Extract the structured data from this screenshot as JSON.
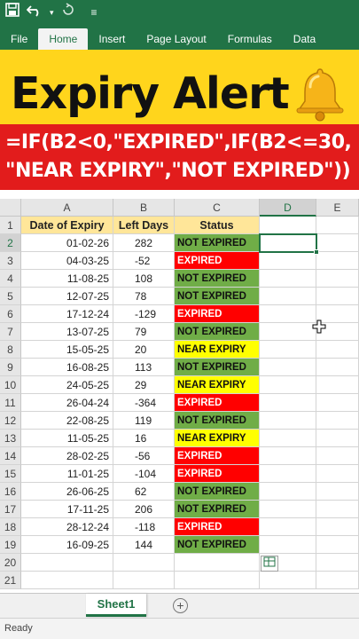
{
  "titlebar": {
    "save_icon": "save-icon",
    "undo_icon": "undo-icon",
    "redo_icon": "redo-icon"
  },
  "ribbon": {
    "tabs": [
      {
        "label": "File",
        "active": false
      },
      {
        "label": "Home",
        "active": true
      },
      {
        "label": "Insert",
        "active": false
      },
      {
        "label": "Page Layout",
        "active": false
      },
      {
        "label": "Formulas",
        "active": false
      },
      {
        "label": "Data",
        "active": false
      }
    ]
  },
  "banner": {
    "title": "Expiry Alert",
    "bg_color": "#ffd51c"
  },
  "formula": {
    "line1": "=IF(B2<0,\"EXPIRED\",IF(B2<=30,",
    "line2": "\"NEAR EXPIRY\",\"NOT EXPIRED\"))",
    "bg_color": "#e21c1c"
  },
  "sheet": {
    "columns": [
      "A",
      "B",
      "C",
      "D",
      "E"
    ],
    "headers": {
      "a": "Date of Expiry",
      "b": "Left Days",
      "c": "Status"
    },
    "rows": [
      {
        "n": "2",
        "date": "01-02-26",
        "days": "282",
        "status": "NOT EXPIRED"
      },
      {
        "n": "3",
        "date": "04-03-25",
        "days": "-52",
        "status": "EXPIRED"
      },
      {
        "n": "4",
        "date": "11-08-25",
        "days": "108",
        "status": "NOT EXPIRED"
      },
      {
        "n": "5",
        "date": "12-07-25",
        "days": "78",
        "status": "NOT EXPIRED"
      },
      {
        "n": "6",
        "date": "17-12-24",
        "days": "-129",
        "status": "EXPIRED"
      },
      {
        "n": "7",
        "date": "13-07-25",
        "days": "79",
        "status": "NOT EXPIRED"
      },
      {
        "n": "8",
        "date": "15-05-25",
        "days": "20",
        "status": "NEAR EXPIRY"
      },
      {
        "n": "9",
        "date": "16-08-25",
        "days": "113",
        "status": "NOT EXPIRED"
      },
      {
        "n": "10",
        "date": "24-05-25",
        "days": "29",
        "status": "NEAR EXPIRY"
      },
      {
        "n": "11",
        "date": "26-04-24",
        "days": "-364",
        "status": "EXPIRED"
      },
      {
        "n": "12",
        "date": "22-08-25",
        "days": "119",
        "status": "NOT EXPIRED"
      },
      {
        "n": "13",
        "date": "11-05-25",
        "days": "16",
        "status": "NEAR EXPIRY"
      },
      {
        "n": "14",
        "date": "28-02-25",
        "days": "-56",
        "status": "EXPIRED"
      },
      {
        "n": "15",
        "date": "11-01-25",
        "days": "-104",
        "status": "EXPIRED"
      },
      {
        "n": "16",
        "date": "26-06-25",
        "days": "62",
        "status": "NOT EXPIRED"
      },
      {
        "n": "17",
        "date": "17-11-25",
        "days": "206",
        "status": "NOT EXPIRED"
      },
      {
        "n": "18",
        "date": "28-12-24",
        "days": "-118",
        "status": "EXPIRED"
      },
      {
        "n": "19",
        "date": "16-09-25",
        "days": "144",
        "status": "NOT EXPIRED"
      }
    ],
    "empty_rows": [
      "20",
      "21"
    ],
    "header_row": "1",
    "status_colors": {
      "NOT EXPIRED": "#70ad47",
      "EXPIRED": "#ff0000",
      "NEAR EXPIRY": "#ffff00"
    },
    "active_cell": "D2"
  },
  "tabs": {
    "sheet_name": "Sheet1",
    "add_icon": "plus-circle-icon"
  },
  "statusbar": {
    "text": "Ready"
  }
}
